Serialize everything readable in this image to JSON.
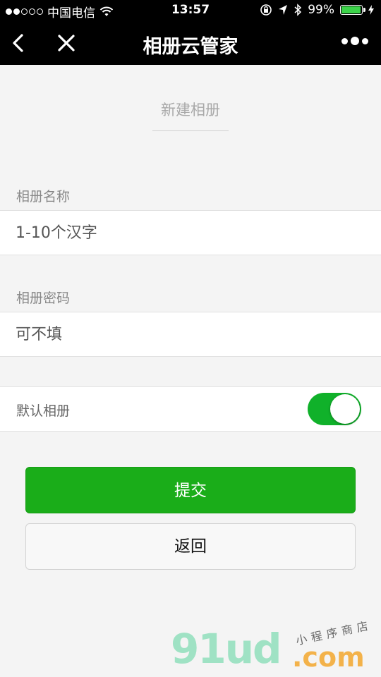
{
  "status_bar": {
    "carrier": "中国电信",
    "time": "13:57",
    "battery_percent": "99%",
    "battery_level": 0.99,
    "battery_color": "#3cd34a",
    "signal_bars_filled": 2,
    "signal_bars_total": 5
  },
  "nav": {
    "title": "相册云管家",
    "back_icon": "chevron-left-icon",
    "close_icon": "close-icon",
    "more_icon": "more-dots-icon"
  },
  "form": {
    "heading": "新建相册",
    "name_label": "相册名称",
    "name_placeholder": "1-10个汉字",
    "name_value": "",
    "password_label": "相册密码",
    "password_placeholder": "可不填",
    "password_value": "",
    "default_label": "默认相册",
    "default_on": true
  },
  "buttons": {
    "submit": "提交",
    "back": "返回"
  },
  "colors": {
    "primary_green": "#1aad19",
    "toggle_green": "#10b12a",
    "nav_bg": "#000000"
  },
  "watermark": {
    "brand": "91ud",
    "domain": ".com",
    "tagline": "小程序商店"
  }
}
